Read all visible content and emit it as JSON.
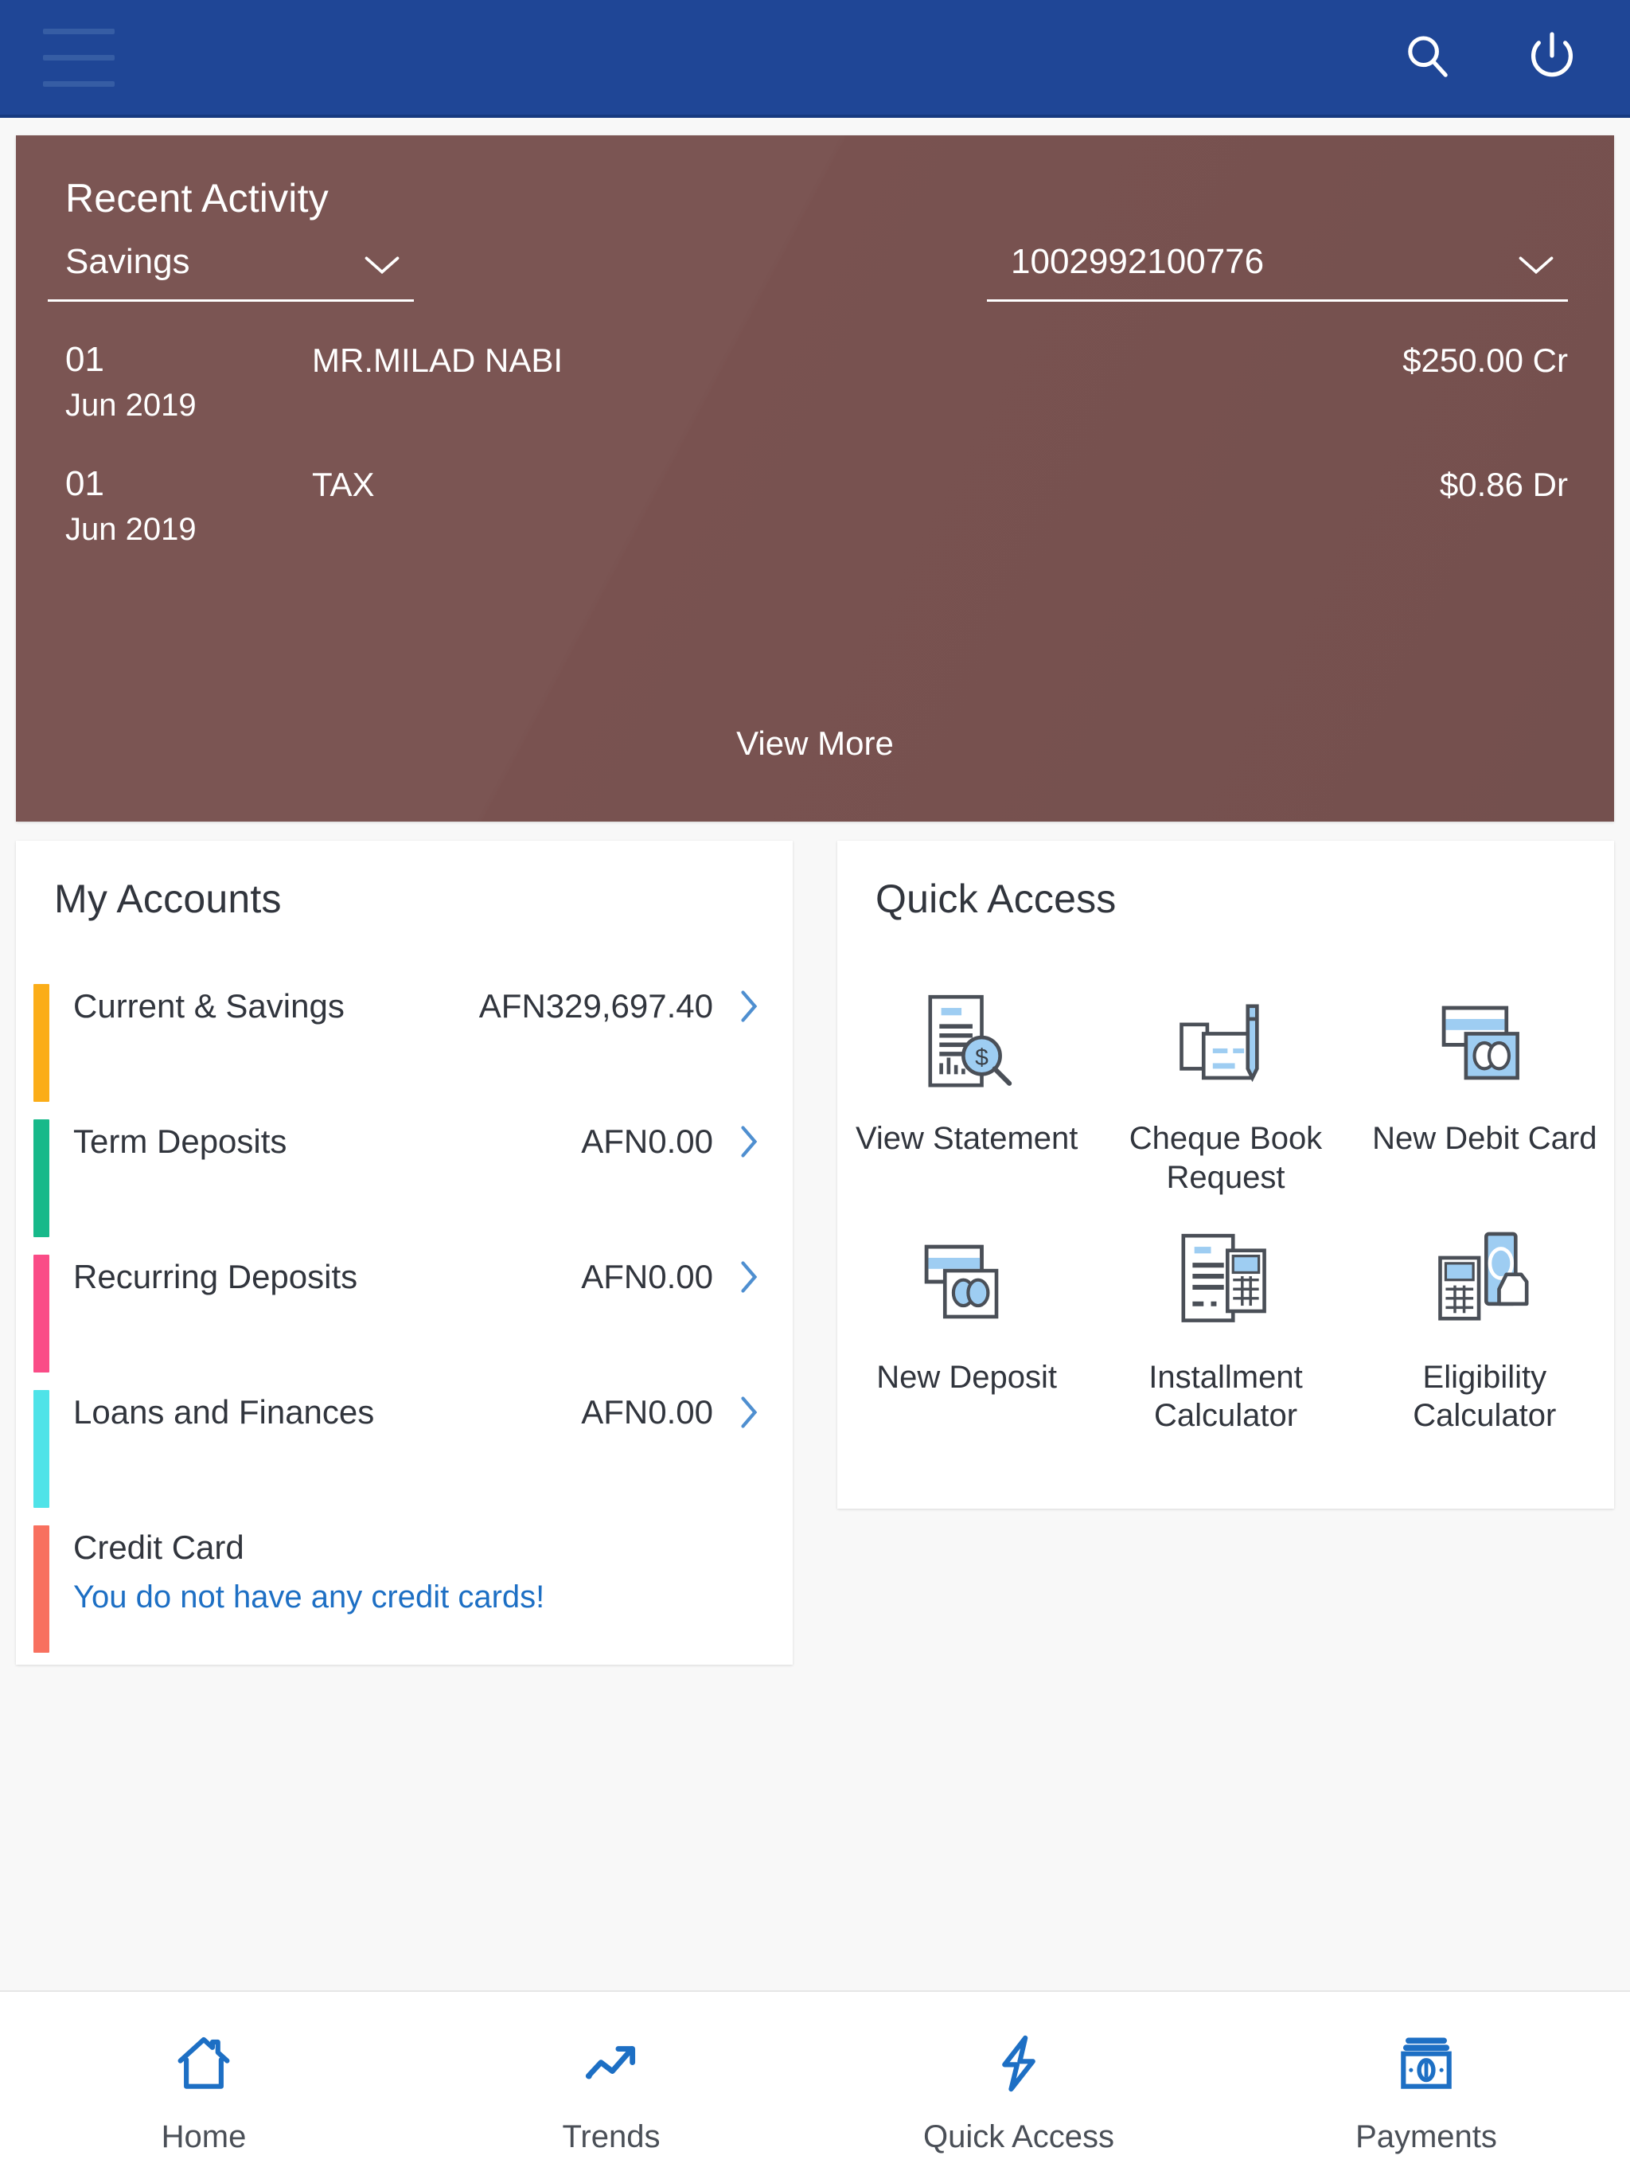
{
  "header": {
    "menu_icon": "hamburger-menu-icon",
    "search_icon": "search-icon",
    "power_icon": "power-icon",
    "background_color": "#1f4696"
  },
  "recent_activity": {
    "title": "Recent Activity",
    "account_type_selected": "Savings",
    "account_number_selected": "1002992100776",
    "card_color": "#77514f",
    "transactions": [
      {
        "day": "01",
        "month_year": "Jun 2019",
        "description": "MR.MILAD NABI",
        "amount": "$250.00 Cr"
      },
      {
        "day": "01",
        "month_year": "Jun 2019",
        "description": "TAX",
        "amount": "$0.86 Dr"
      }
    ],
    "view_more_label": "View More"
  },
  "my_accounts": {
    "title": "My Accounts",
    "rows": [
      {
        "label": "Current & Savings",
        "amount": "AFN329,697.40",
        "color": "#fbad18",
        "has_chevron": true
      },
      {
        "label": "Term Deposits",
        "amount": "AFN0.00",
        "color": "#17b98a",
        "has_chevron": true
      },
      {
        "label": "Recurring Deposits",
        "amount": "AFN0.00",
        "color": "#fa4c87",
        "has_chevron": true
      },
      {
        "label": "Loans and Finances",
        "amount": "AFN0.00",
        "color": "#4fe3e8",
        "has_chevron": true
      },
      {
        "label": "Credit Card",
        "sublabel": "You do not have any credit cards!",
        "color": "#f8705f",
        "has_chevron": false
      }
    ],
    "link_color": "#1d6fc4"
  },
  "quick_access": {
    "title": "Quick Access",
    "items": [
      {
        "label": "View Statement",
        "icon": "document-search-dollar-icon"
      },
      {
        "label": "Cheque Book Request",
        "icon": "cheque-book-pen-icon"
      },
      {
        "label": "New Debit Card",
        "icon": "debit-card-icon"
      },
      {
        "label": "New Deposit",
        "icon": "deposit-card-icon"
      },
      {
        "label": "Installment Calculator",
        "icon": "document-calculator-icon"
      },
      {
        "label": "Eligibility Calculator",
        "icon": "calculator-hand-cash-icon"
      }
    ]
  },
  "bottom_nav": {
    "items": [
      {
        "label": "Home",
        "icon": "home-icon"
      },
      {
        "label": "Trends",
        "icon": "trend-up-icon"
      },
      {
        "label": "Quick Access",
        "icon": "lightning-bolt-icon"
      },
      {
        "label": "Payments",
        "icon": "cash-payment-icon"
      }
    ],
    "accent_color": "#1d6fc4"
  }
}
